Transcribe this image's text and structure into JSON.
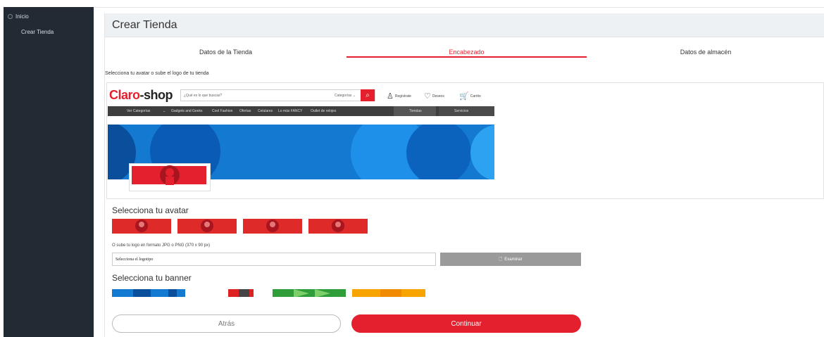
{
  "sidebar": {
    "items": [
      {
        "label": "Inicio",
        "icon": "home-icon"
      },
      {
        "label": "Crear Tienda"
      }
    ]
  },
  "page": {
    "title": "Crear Tienda",
    "tabs": [
      {
        "label": "Datos de la Tienda",
        "active": false
      },
      {
        "label": "Encabezado",
        "active": true
      },
      {
        "label": "Datos de almacén",
        "active": false
      }
    ],
    "instruction": "Selecciona tu avatar o sube el logo de tu tienda"
  },
  "preview": {
    "logo_a": "Claro",
    "logo_b": "-shop",
    "search_placeholder": "¿Qué es lo que buscas?",
    "search_category": "Categorías ⌄",
    "icons": [
      {
        "name": "user-icon",
        "label": "Regístrate"
      },
      {
        "name": "heart-icon",
        "label": "Deseos"
      },
      {
        "name": "cart-icon",
        "label": "Carrito"
      }
    ],
    "nav": [
      "Ver Categorías",
      "⌄",
      "Gadgets and Geeks",
      "Cool Fashion",
      "Ofertas",
      "Celulares",
      "Lo más FANCY",
      "Outlet de relojes"
    ],
    "nav_right": [
      "Tiendas",
      "Servicios"
    ]
  },
  "avatar": {
    "title": "Selecciona tu avatar",
    "upload_note": "O sube tu logo en formato JPG o PNG (370 x 90 px)",
    "file_value": "Selecciona el logotipo",
    "browse_label": "Examinar"
  },
  "banner": {
    "title": "Selecciona tu banner"
  },
  "actions": {
    "back": "Atrás",
    "continue": "Continuar"
  },
  "colors": {
    "accent": "#e4202e",
    "sidebar_bg": "#222a33"
  }
}
